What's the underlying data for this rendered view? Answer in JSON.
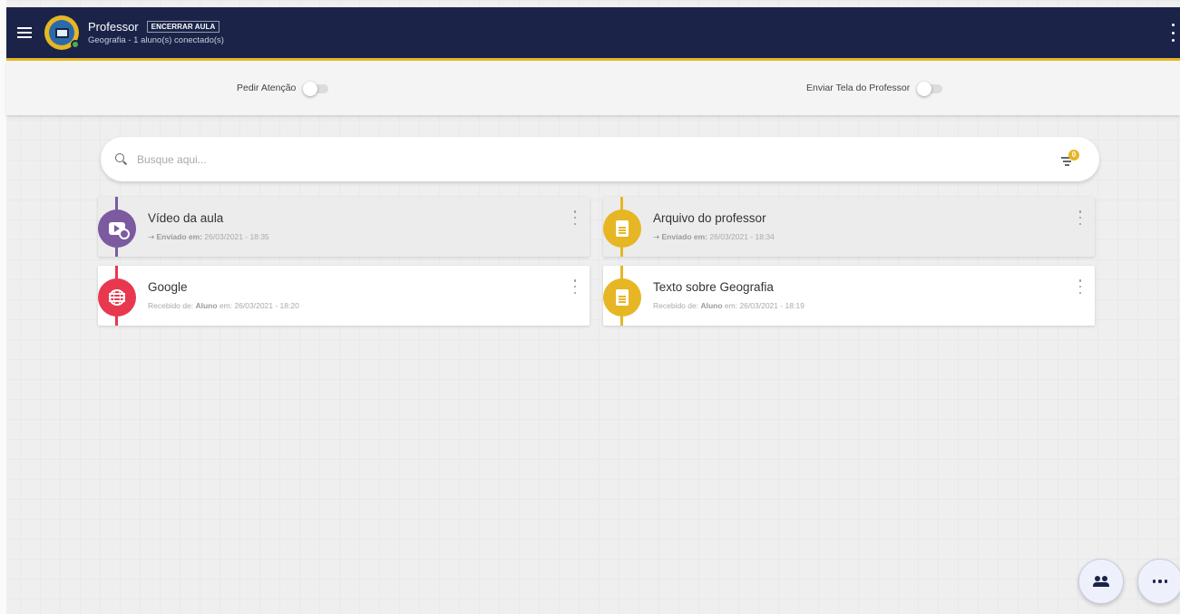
{
  "header": {
    "title": "Professor",
    "end_button": "ENCERRAR AULA",
    "subtitle": "Geografia - 1 aluno(s) conectado(s)"
  },
  "toolbar": {
    "attention_label": "Pedir Atenção",
    "share_screen_label": "Enviar Tela do Professor",
    "attention_on": false,
    "share_screen_on": false
  },
  "search": {
    "placeholder": "Busque aqui...",
    "value": "",
    "filter_count": "0"
  },
  "items": [
    {
      "title": "Vídeo da aula",
      "meta_prefix": "➝ Enviado em:",
      "meta_sender": "",
      "meta_date": "26/03/2021 - 18:35",
      "icon": "video-icon",
      "color": "#7b5aa0",
      "status": "sent"
    },
    {
      "title": "Arquivo do professor",
      "meta_prefix": "➝ Enviado em:",
      "meta_sender": "",
      "meta_date": "26/03/2021 - 18:34",
      "icon": "document-icon",
      "color": "#e6b625",
      "status": "sent"
    },
    {
      "title": "Google",
      "meta_prefix": "Recebido de:",
      "meta_sender": "Aluno",
      "meta_date": "em: 26/03/2021 - 18:20",
      "icon": "globe-icon",
      "color": "#e8384f",
      "status": "received"
    },
    {
      "title": "Texto sobre Geografia",
      "meta_prefix": "Recebido de:",
      "meta_sender": "Aluno",
      "meta_date": "em: 26/03/2021 - 18:19",
      "icon": "document-icon",
      "color": "#e6b625",
      "status": "received"
    }
  ],
  "colors": {
    "header_bg": "#1b2448",
    "accent": "#e6b625"
  }
}
